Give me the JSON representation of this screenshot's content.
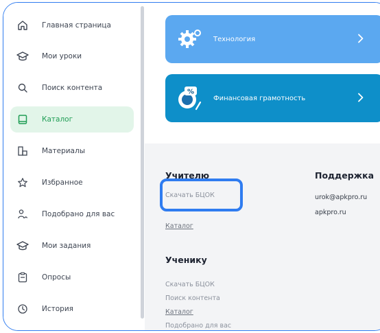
{
  "sidebar": {
    "items": [
      {
        "label": "Главная страница",
        "icon": "home-icon"
      },
      {
        "label": "Мои уроки",
        "icon": "graduation-cap-icon"
      },
      {
        "label": "Поиск контента",
        "icon": "search-icon"
      },
      {
        "label": "Каталог",
        "icon": "book-icon",
        "active": true
      },
      {
        "label": "Материалы",
        "icon": "materials-icon"
      },
      {
        "label": "Избранное",
        "icon": "star-icon"
      },
      {
        "label": "Подобрано для вас",
        "icon": "users-icon"
      },
      {
        "label": "Мои задания",
        "icon": "graduation-cap-icon"
      },
      {
        "label": "Опросы",
        "icon": "clipboard-icon"
      },
      {
        "label": "История",
        "icon": "clock-icon"
      }
    ]
  },
  "cards": [
    {
      "label": "Технология",
      "color": "#5ba8f0",
      "icon": "gears-icon"
    },
    {
      "label": "Финансовая грамотность",
      "color": "#0e8fc9",
      "icon": "percent-icon"
    }
  ],
  "footer": {
    "teacher": {
      "heading": "Учителю",
      "links": [
        "Скачать БЦОК",
        "Каталог"
      ]
    },
    "student": {
      "heading": "Ученику",
      "links": [
        "Скачать БЦОК",
        "Поиск контента",
        "Каталог",
        "Подобрано для вас"
      ]
    },
    "support": {
      "heading": "Поддержка",
      "email": "urok@apkpro.ru",
      "site": "apkpro.ru"
    }
  },
  "colors": {
    "accent": "#2f7cf0",
    "active_bg": "#e2f5e9",
    "active_text": "#1f9d55"
  }
}
